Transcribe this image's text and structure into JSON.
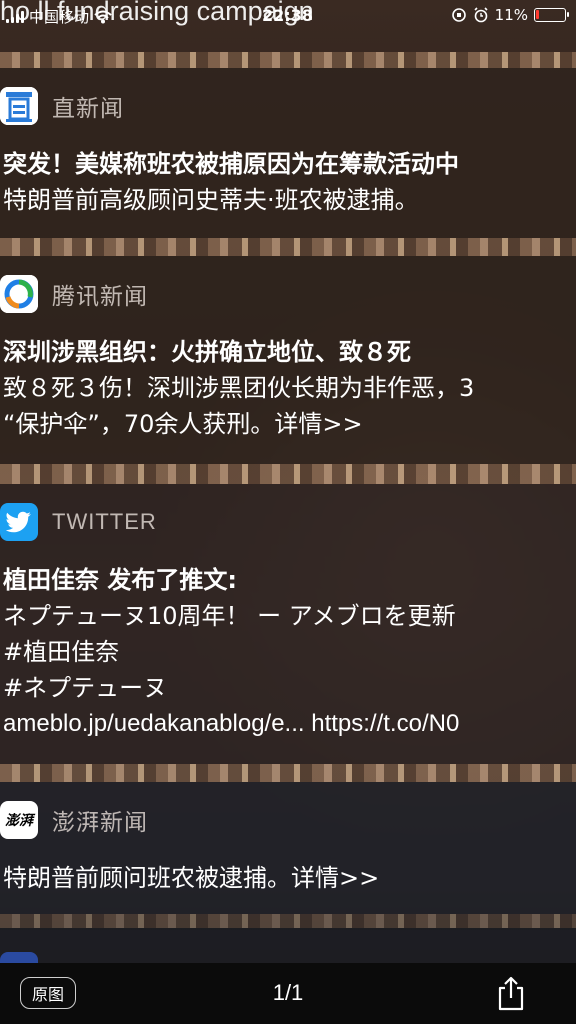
{
  "status_bar": {
    "background_headline": "ho                     ll fundraising campaign",
    "carrier": "中国移动",
    "time": "22:38",
    "battery": "11%",
    "battery_level": 0.11,
    "battery_color": "#ff3b30"
  },
  "notifications": [
    {
      "app": "直新闻",
      "icon": "zhi-news-icon",
      "lines": [
        "突发！美媒称班农被捕原因为在筹款活动中",
        "特朗普前高级顾问史蒂夫·班农被逮捕。"
      ]
    },
    {
      "app": "腾讯新闻",
      "icon": "tencent-news-icon",
      "lines": [
        "深圳涉黑组织：火拼确立地位、致８死",
        "致８死３伤！深圳涉黑团伙长期为非作恶，3",
        "“保护伞”，70余人获刑。详情>>"
      ]
    },
    {
      "app": "TWITTER",
      "icon": "twitter-bird-icon",
      "lines": [
        "植田佳奈 发布了推文:",
        "ネプテューヌ10周年！ ー アメブロを更新",
        "#植田佳奈",
        "#ネプテューヌ",
        "ameblo.jp/uedakanablog/e... https://t.co/N0"
      ]
    },
    {
      "app": "澎湃新闻",
      "icon": "thepaper-icon",
      "icon_text": "澎湃",
      "lines": [
        "特朗普前顾问班农被逮捕。详情>>"
      ]
    }
  ],
  "toolbar": {
    "original_label": "原图",
    "page_indicator": "1/1",
    "share_icon": "share-icon"
  },
  "colors": {
    "twitter_blue": "#1da1f2",
    "tencent_blue": "#1f7fe5",
    "tencent_green": "#2cb14a",
    "tencent_orange": "#f08c1e",
    "zhi_blue": "#2a7bd8"
  }
}
